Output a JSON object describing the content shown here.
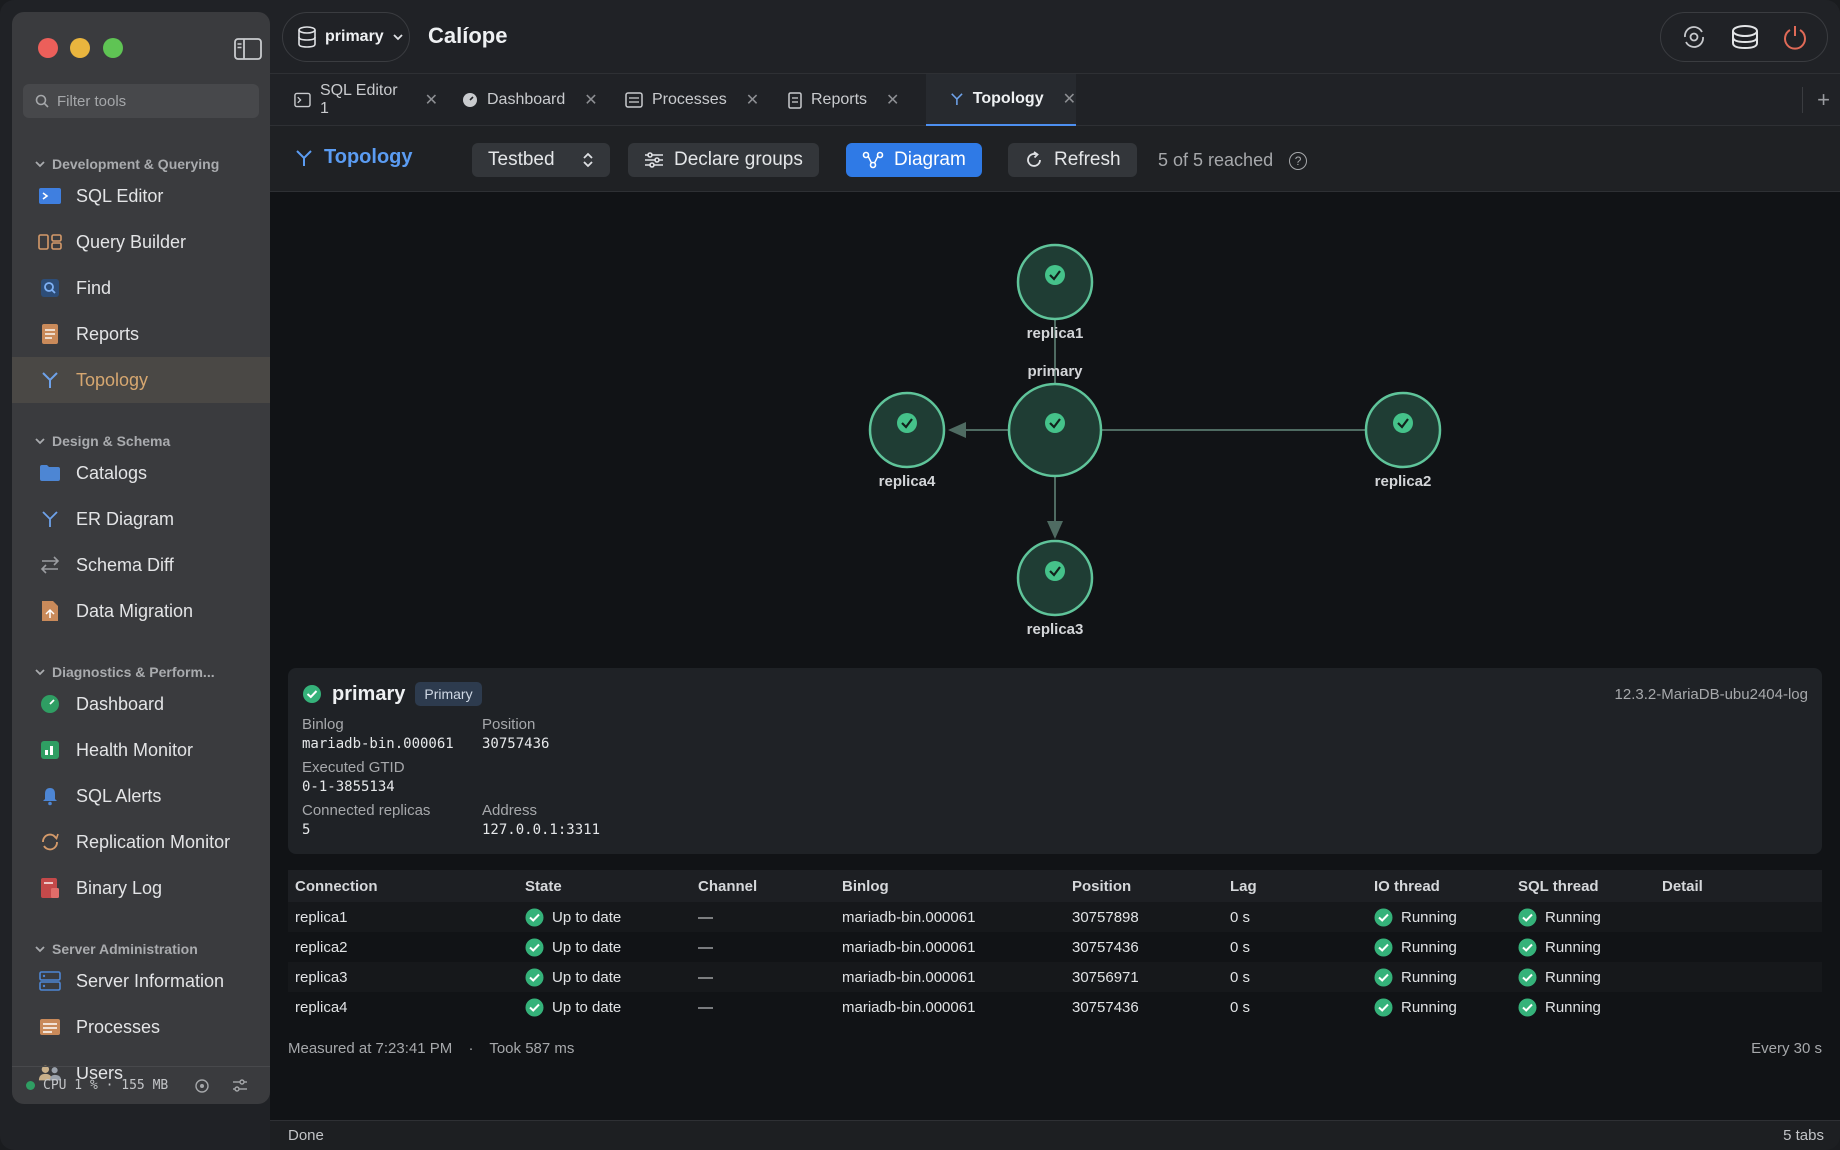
{
  "app": {
    "title": "Calíope",
    "connection": "primary"
  },
  "sidebar": {
    "filter_placeholder": "Filter tools",
    "sections": [
      {
        "title": "Development & Querying",
        "items": [
          "SQL Editor",
          "Query Builder",
          "Find",
          "Reports",
          "Topology"
        ]
      },
      {
        "title": "Design & Schema",
        "items": [
          "Catalogs",
          "ER Diagram",
          "Schema Diff",
          "Data Migration"
        ]
      },
      {
        "title": "Diagnostics & Perform...",
        "items": [
          "Dashboard",
          "Health Monitor",
          "SQL Alerts",
          "Replication Monitor",
          "Binary Log"
        ]
      },
      {
        "title": "Server Administration",
        "items": [
          "Server Information",
          "Processes",
          "Users"
        ]
      }
    ],
    "active_item": "Topology",
    "status": "CPU 1 % · 155 MB"
  },
  "tabs": [
    "SQL Editor 1",
    "Dashboard",
    "Processes",
    "Reports",
    "Topology"
  ],
  "active_tab": "Topology",
  "page": {
    "title": "Topology",
    "group_select": "Testbed",
    "declare_groups": "Declare groups",
    "diagram": "Diagram",
    "refresh": "Refresh",
    "reached": "5 of 5 reached"
  },
  "diagram": {
    "nodes": [
      "primary",
      "replica1",
      "replica2",
      "replica3",
      "replica4"
    ]
  },
  "card": {
    "name": "primary",
    "badge": "Primary",
    "version": "12.3.2-MariaDB-ubu2404-log",
    "binlog_label": "Binlog",
    "binlog": "mariadb-bin.000061",
    "position_label": "Position",
    "position": "30757436",
    "gtid_label": "Executed GTID",
    "gtid": "0-1-3855134",
    "replicas_label": "Connected replicas",
    "replicas": "5",
    "address_label": "Address",
    "address": "127.0.0.1:3311"
  },
  "table": {
    "headers": [
      "Connection",
      "State",
      "Channel",
      "Binlog",
      "Position",
      "Lag",
      "IO thread",
      "SQL thread",
      "Detail"
    ],
    "rows": [
      [
        "replica1",
        "Up to date",
        "—",
        "mariadb-bin.000061",
        "30757898",
        "0 s",
        "Running",
        "Running",
        ""
      ],
      [
        "replica2",
        "Up to date",
        "—",
        "mariadb-bin.000061",
        "30757436",
        "0 s",
        "Running",
        "Running",
        ""
      ],
      [
        "replica3",
        "Up to date",
        "—",
        "mariadb-bin.000061",
        "30756971",
        "0 s",
        "Running",
        "Running",
        ""
      ],
      [
        "replica4",
        "Up to date",
        "—",
        "mariadb-bin.000061",
        "30757436",
        "0 s",
        "Running",
        "Running",
        ""
      ]
    ]
  },
  "footer": {
    "measured": "Measured at 7:23:41 PM",
    "took": "Took 587 ms",
    "every": "Every 30 s"
  },
  "statusbar": {
    "left": "Done",
    "right": "5 tabs"
  },
  "colors": {
    "accent": "#2f7ae6",
    "ok": "#35b27a",
    "active_nav": "#d6a770"
  }
}
